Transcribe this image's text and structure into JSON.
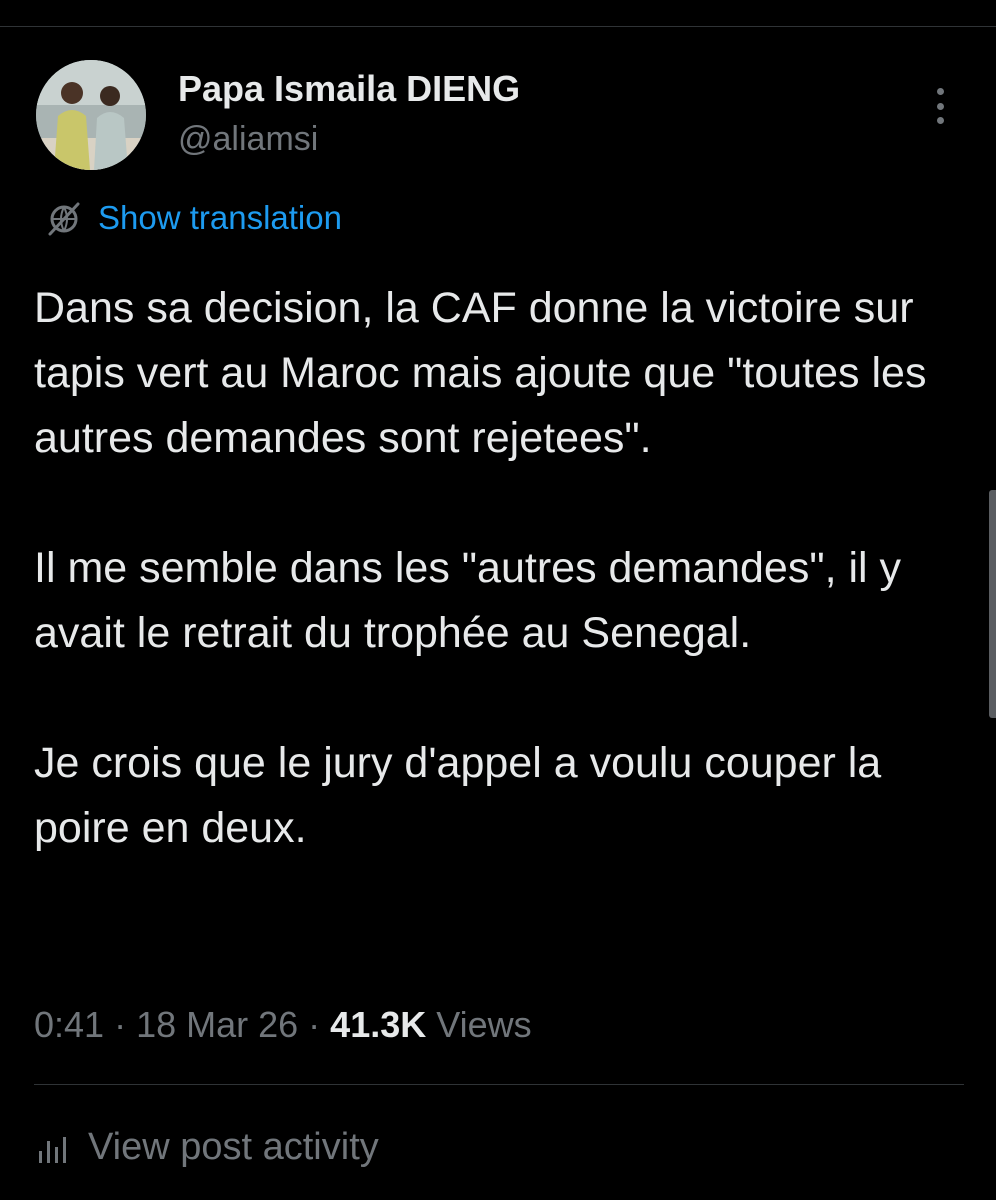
{
  "author": {
    "name": "Papa Ismaila DIENG",
    "handle": "@aliamsi"
  },
  "post": {
    "translate_label": "Show translation",
    "paragraphs": [
      "Dans sa decision, la CAF donne la victoire sur tapis vert au Maroc mais ajoute que \"toutes les autres demandes sont rejetees\".",
      "Il me semble dans les \"autres demandes\", il y avait le retrait du trophée au Senegal.",
      "Je crois que le jury d'appel a voulu couper la poire en deux."
    ],
    "time": "0:41",
    "date": "18 Mar 26",
    "separator": " · ",
    "views_count": "41.3K",
    "views_label": " Views"
  },
  "actions": {
    "view_activity_label": "View post activity"
  },
  "icons": {
    "more": "more-vertical-icon",
    "translate": "translate-globe-icon",
    "activity": "bar-chart-icon"
  },
  "colors": {
    "background": "#000000",
    "text_primary": "#e7e9ea",
    "text_secondary": "#71767b",
    "accent": "#1d9bf0",
    "divider": "#2f3336"
  }
}
